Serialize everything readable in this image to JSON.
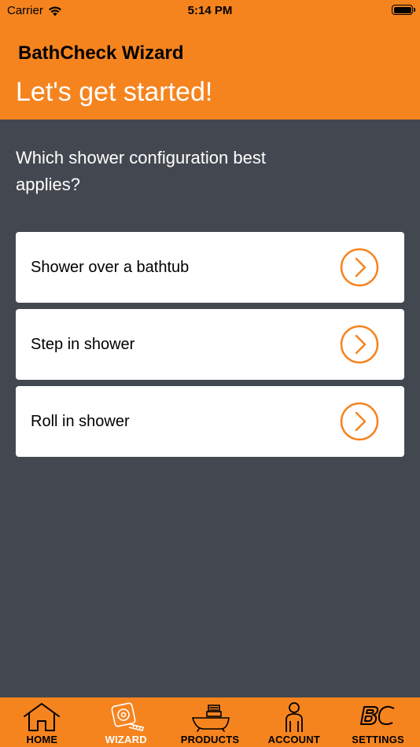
{
  "status_bar": {
    "carrier": "Carrier",
    "time": "5:14 PM",
    "wifi_icon": "wifi-icon",
    "battery_icon": "battery-icon"
  },
  "header": {
    "app_title": "BathCheck Wizard",
    "page_title": "Let's get started!"
  },
  "question": "Which shower configuration best applies?",
  "options": [
    {
      "label": "Shower over a bathtub",
      "icon": "chevron-right-circle-icon"
    },
    {
      "label": "Step in shower",
      "icon": "chevron-right-circle-icon"
    },
    {
      "label": "Roll in shower",
      "icon": "chevron-right-circle-icon"
    }
  ],
  "tabs": [
    {
      "label": "HOME",
      "icon": "house-icon",
      "active": false
    },
    {
      "label": "WIZARD",
      "icon": "tape-measure-icon",
      "active": true
    },
    {
      "label": "PRODUCTS",
      "icon": "bath-seat-icon",
      "active": false
    },
    {
      "label": "ACCOUNT",
      "icon": "person-icon",
      "active": false
    },
    {
      "label": "SETTINGS",
      "icon": "bc-logo-icon",
      "active": false
    }
  ],
  "colors": {
    "brand_orange": "#F5841F",
    "background": "#434850",
    "card": "#FFFFFF",
    "arrow": "#F5841F"
  }
}
